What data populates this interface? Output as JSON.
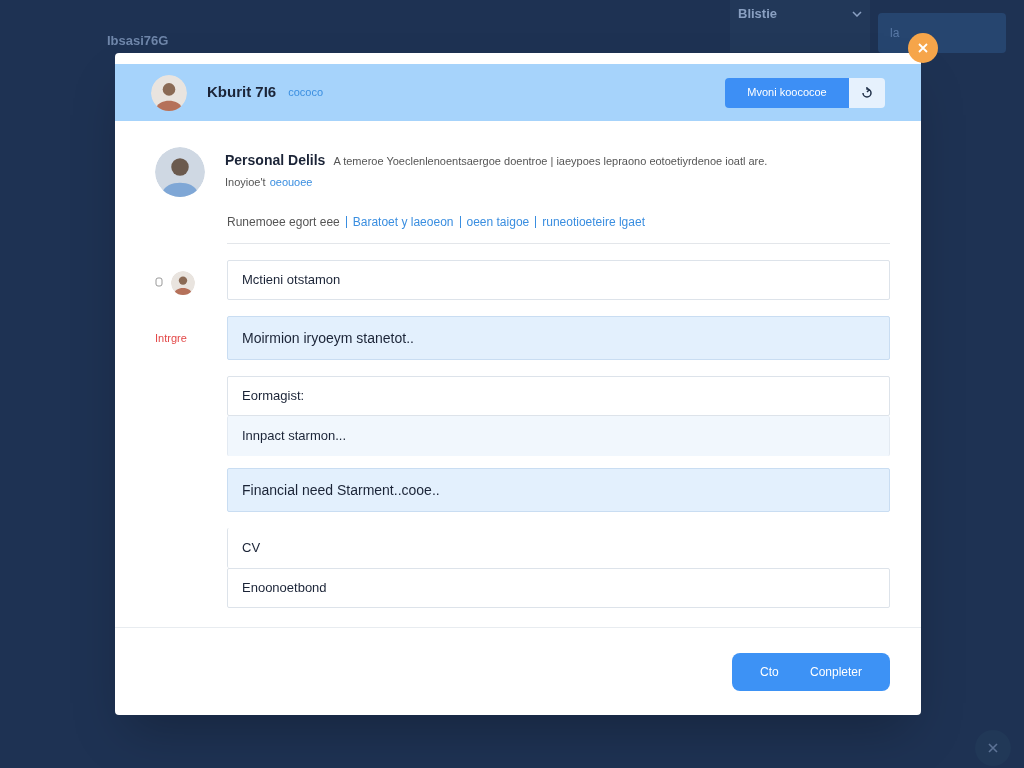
{
  "background": {
    "title": "Ibsasi76G",
    "dropdown": {
      "label": "Blistie"
    },
    "card": {
      "label": "la"
    }
  },
  "dialog": {
    "header": {
      "name": "Kburit 7I6",
      "tag": "cococo",
      "primary_button": "Mvoni koococoe"
    },
    "profile": {
      "title": "Personal Delils",
      "description": "A temeroe Yoeclenlenoentsaergoe doentroe | iaeypoes lepraono eotoetiyrdenoe ioatl are.",
      "note": "Inoyioe't",
      "note_link": "oeouoee"
    },
    "links": {
      "lead": "Runemoee egort eee",
      "items": [
        "Baratoet y laeoeon",
        "oeen taigoe",
        "runeotioeteire lgaet"
      ]
    },
    "rows": [
      {
        "label": "",
        "avatar": true,
        "fields": [
          {
            "value": "Mctieni otstamon",
            "kind": "plain"
          }
        ]
      },
      {
        "label": "Intrgre",
        "avatar": false,
        "fields": [
          {
            "value": "Moirmion iryoeym stanetot..",
            "kind": "highlighted"
          }
        ]
      },
      {
        "label": "",
        "avatar": false,
        "fields": [
          {
            "value": "Eormagist:",
            "kind": "plain"
          },
          {
            "value": "Innpact starmon...",
            "kind": "tinted"
          },
          {
            "value": "Financial need Starment..cooe..",
            "kind": "highlighted",
            "gap": true
          }
        ]
      },
      {
        "label": "",
        "avatar": false,
        "fields": [
          {
            "value": "CV",
            "kind": "open"
          },
          {
            "value": "Enoonoetbond",
            "kind": "plain"
          }
        ]
      }
    ],
    "footer_button": "Cto Conpleter"
  }
}
